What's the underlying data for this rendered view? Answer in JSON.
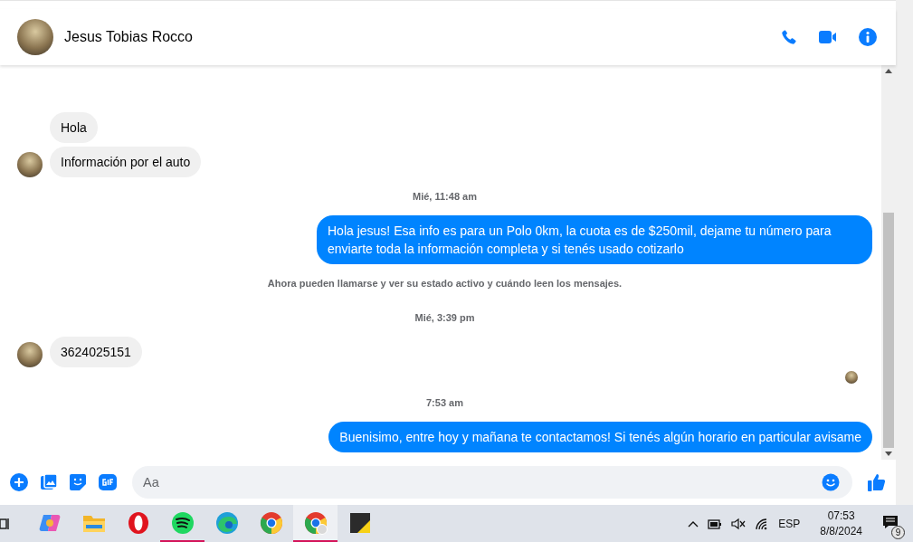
{
  "chat": {
    "contact_name": "Jesus Tobias Rocco"
  },
  "messages": [
    {
      "kind": "incoming",
      "text": "Hola",
      "avatar": false
    },
    {
      "kind": "incoming",
      "text": "Información por el auto",
      "avatar": true
    },
    {
      "kind": "time",
      "text": "Mié, 11:48 am"
    },
    {
      "kind": "outgoing",
      "text": "Hola jesus! Esa info es para un Polo 0km, la cuota es de $250mil, dejame tu número para enviarte toda la información completa y si tenés usado cotizarlo"
    },
    {
      "kind": "notice",
      "text": "Ahora pueden llamarse y ver su estado activo y cuándo leen los mensajes."
    },
    {
      "kind": "time",
      "text": "Mié, 3:39 pm"
    },
    {
      "kind": "incoming",
      "text": "3624025151",
      "avatar": true
    },
    {
      "kind": "seen"
    },
    {
      "kind": "time",
      "text": "7:53 am"
    },
    {
      "kind": "outgoing",
      "text": "Buenisimo, entre hoy y mañana te contactamos! Si tenés algún horario en particular avisame"
    }
  ],
  "composer": {
    "placeholder": "Aa"
  },
  "taskbar": {
    "apps": [
      {
        "kind": "copilot",
        "running": false
      },
      {
        "kind": "folder",
        "running": false
      },
      {
        "kind": "opera",
        "running": false
      },
      {
        "kind": "spotify",
        "running": true
      },
      {
        "kind": "edge",
        "running": false
      },
      {
        "kind": "chrome",
        "running": false
      },
      {
        "kind": "chrome-profile",
        "running": true
      },
      {
        "kind": "notes",
        "running": false
      }
    ],
    "language": "ESP",
    "time": "07:53",
    "date": "8/8/2024",
    "notifications": "9"
  }
}
